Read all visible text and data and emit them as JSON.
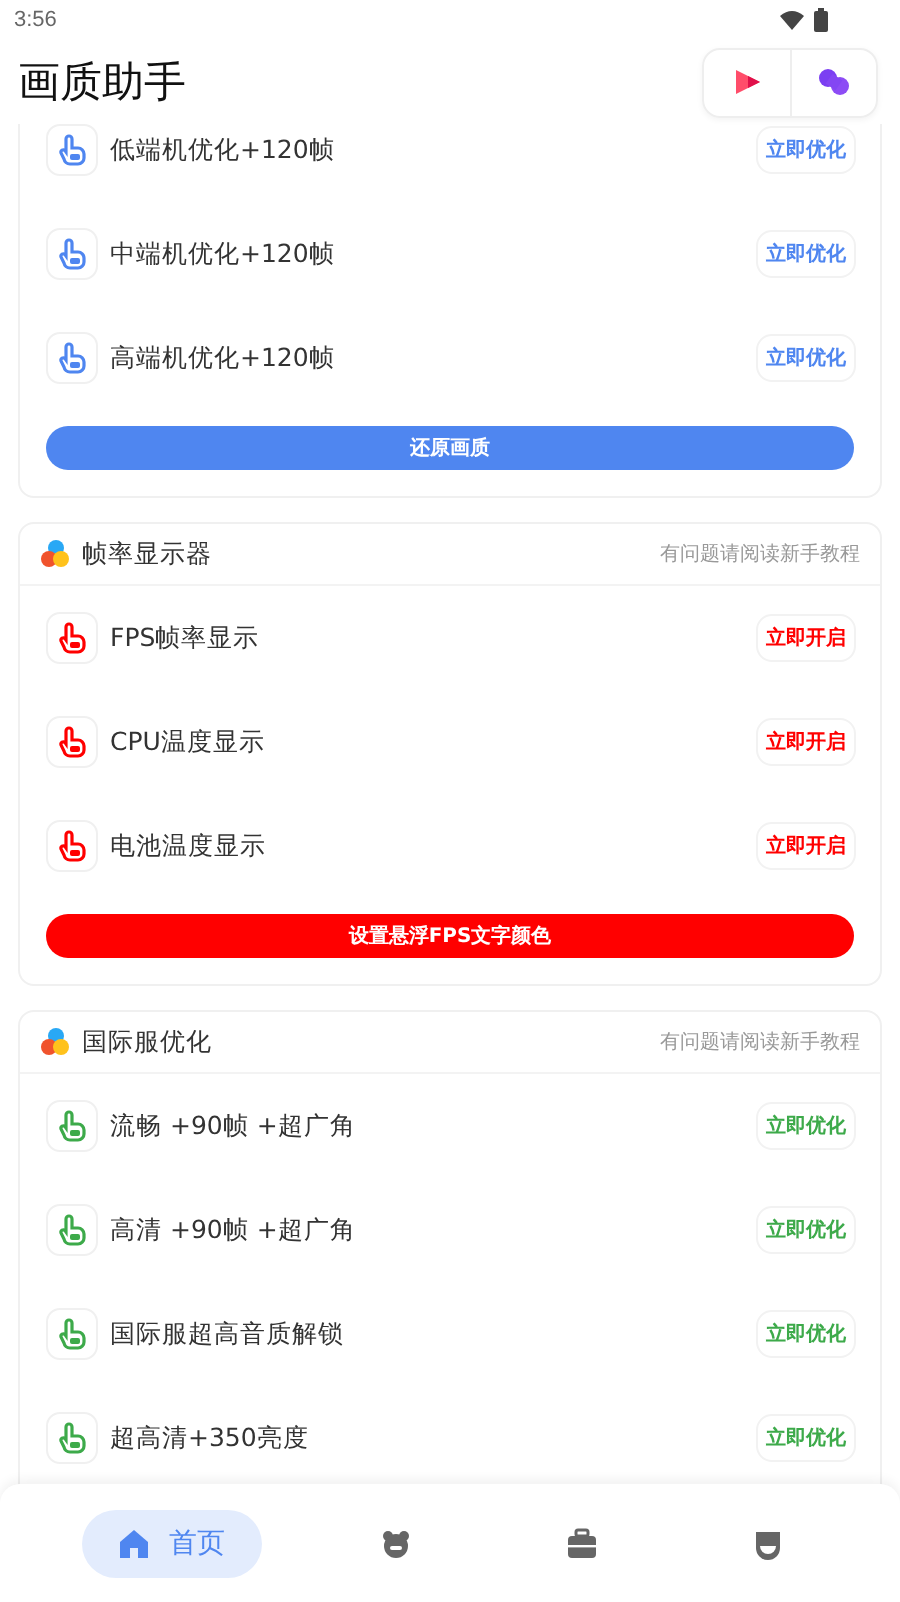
{
  "status_bar": {
    "time": "3:56"
  },
  "app_bar": {
    "title": "画质助手"
  },
  "sections": [
    {
      "color": "#4f86f0",
      "items": [
        {
          "label": "低端机优化+120帧",
          "action": "立即优化"
        },
        {
          "label": "中端机优化+120帧",
          "action": "立即优化"
        },
        {
          "label": "高端机优化+120帧",
          "action": "立即优化"
        }
      ],
      "footer_button": "还原画质"
    },
    {
      "color": "#ff0000",
      "title": "帧率显示器",
      "hint": "有问题请阅读新手教程",
      "items": [
        {
          "label": "FPS帧率显示",
          "action": "立即开启"
        },
        {
          "label": "CPU温度显示",
          "action": "立即开启"
        },
        {
          "label": "电池温度显示",
          "action": "立即开启"
        }
      ],
      "footer_button": "设置悬浮FPS文字颜色"
    },
    {
      "color": "#3daa4a",
      "title": "国际服优化",
      "hint": "有问题请阅读新手教程",
      "items": [
        {
          "label": "流畅 +90帧 +超广角",
          "action": "立即优化"
        },
        {
          "label": "高清 +90帧 +超广角",
          "action": "立即优化"
        },
        {
          "label": "国际服超高音质解锁",
          "action": "立即优化"
        },
        {
          "label": "超高清+350亮度",
          "action": "立即优化"
        }
      ]
    }
  ],
  "bottom_nav": [
    {
      "kind": "home",
      "label": "首页",
      "selected": true
    },
    {
      "kind": "pet",
      "selected": false
    },
    {
      "kind": "bag",
      "selected": false
    },
    {
      "kind": "shield",
      "selected": false
    }
  ]
}
